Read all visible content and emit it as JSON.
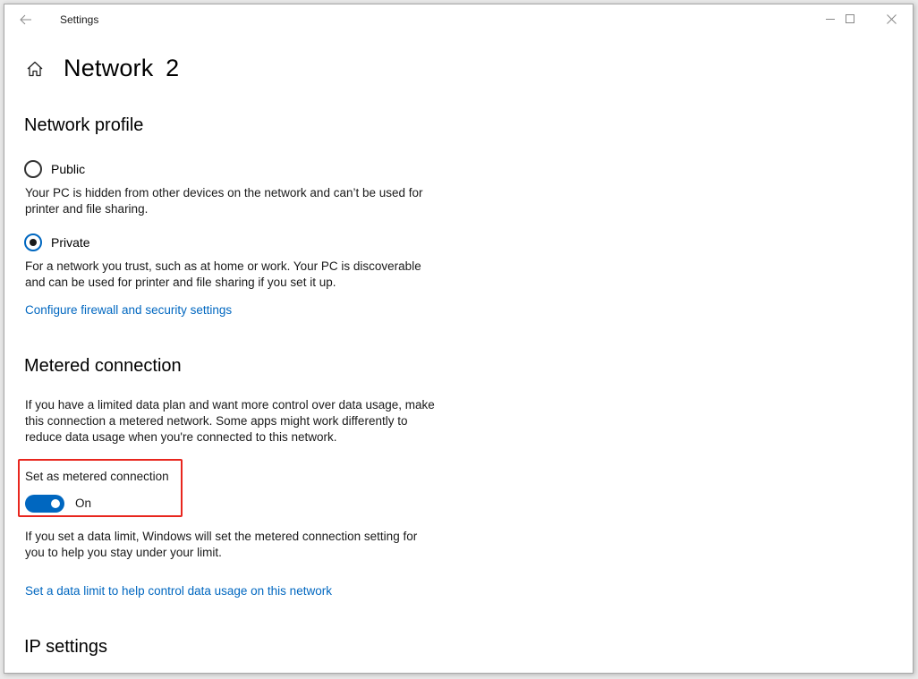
{
  "window": {
    "app_title": "Settings",
    "controls": {
      "minimize": "minimize",
      "maximize": "maximize",
      "close": "close"
    }
  },
  "header": {
    "title": "Network  2"
  },
  "network_profile": {
    "title": "Network profile",
    "options": [
      {
        "label": "Public",
        "checked": false,
        "description": "Your PC is hidden from other devices on the network and can’t be used for printer and file sharing."
      },
      {
        "label": "Private",
        "checked": true,
        "description": "For a network you trust, such as at home or work. Your PC is discoverable and can be used for printer and file sharing if you set it up."
      }
    ],
    "link": "Configure firewall and security settings"
  },
  "metered": {
    "title": "Metered connection",
    "description": "If you have a limited data plan and want more control over data usage, make this connection a metered network. Some apps might work differently to reduce data usage when you're connected to this network.",
    "toggle_label": "Set as metered connection",
    "toggle_state": "On",
    "toggle_on": true,
    "highlight_color": "#e8261e",
    "data_limit_desc": "If you set a data limit, Windows will set the metered connection setting for you to help you stay under your limit.",
    "data_limit_link": "Set a data limit to help control data usage on this network"
  },
  "ip_settings": {
    "title": "IP settings"
  },
  "colors": {
    "accent": "#0067c0",
    "link": "#0067c0"
  }
}
